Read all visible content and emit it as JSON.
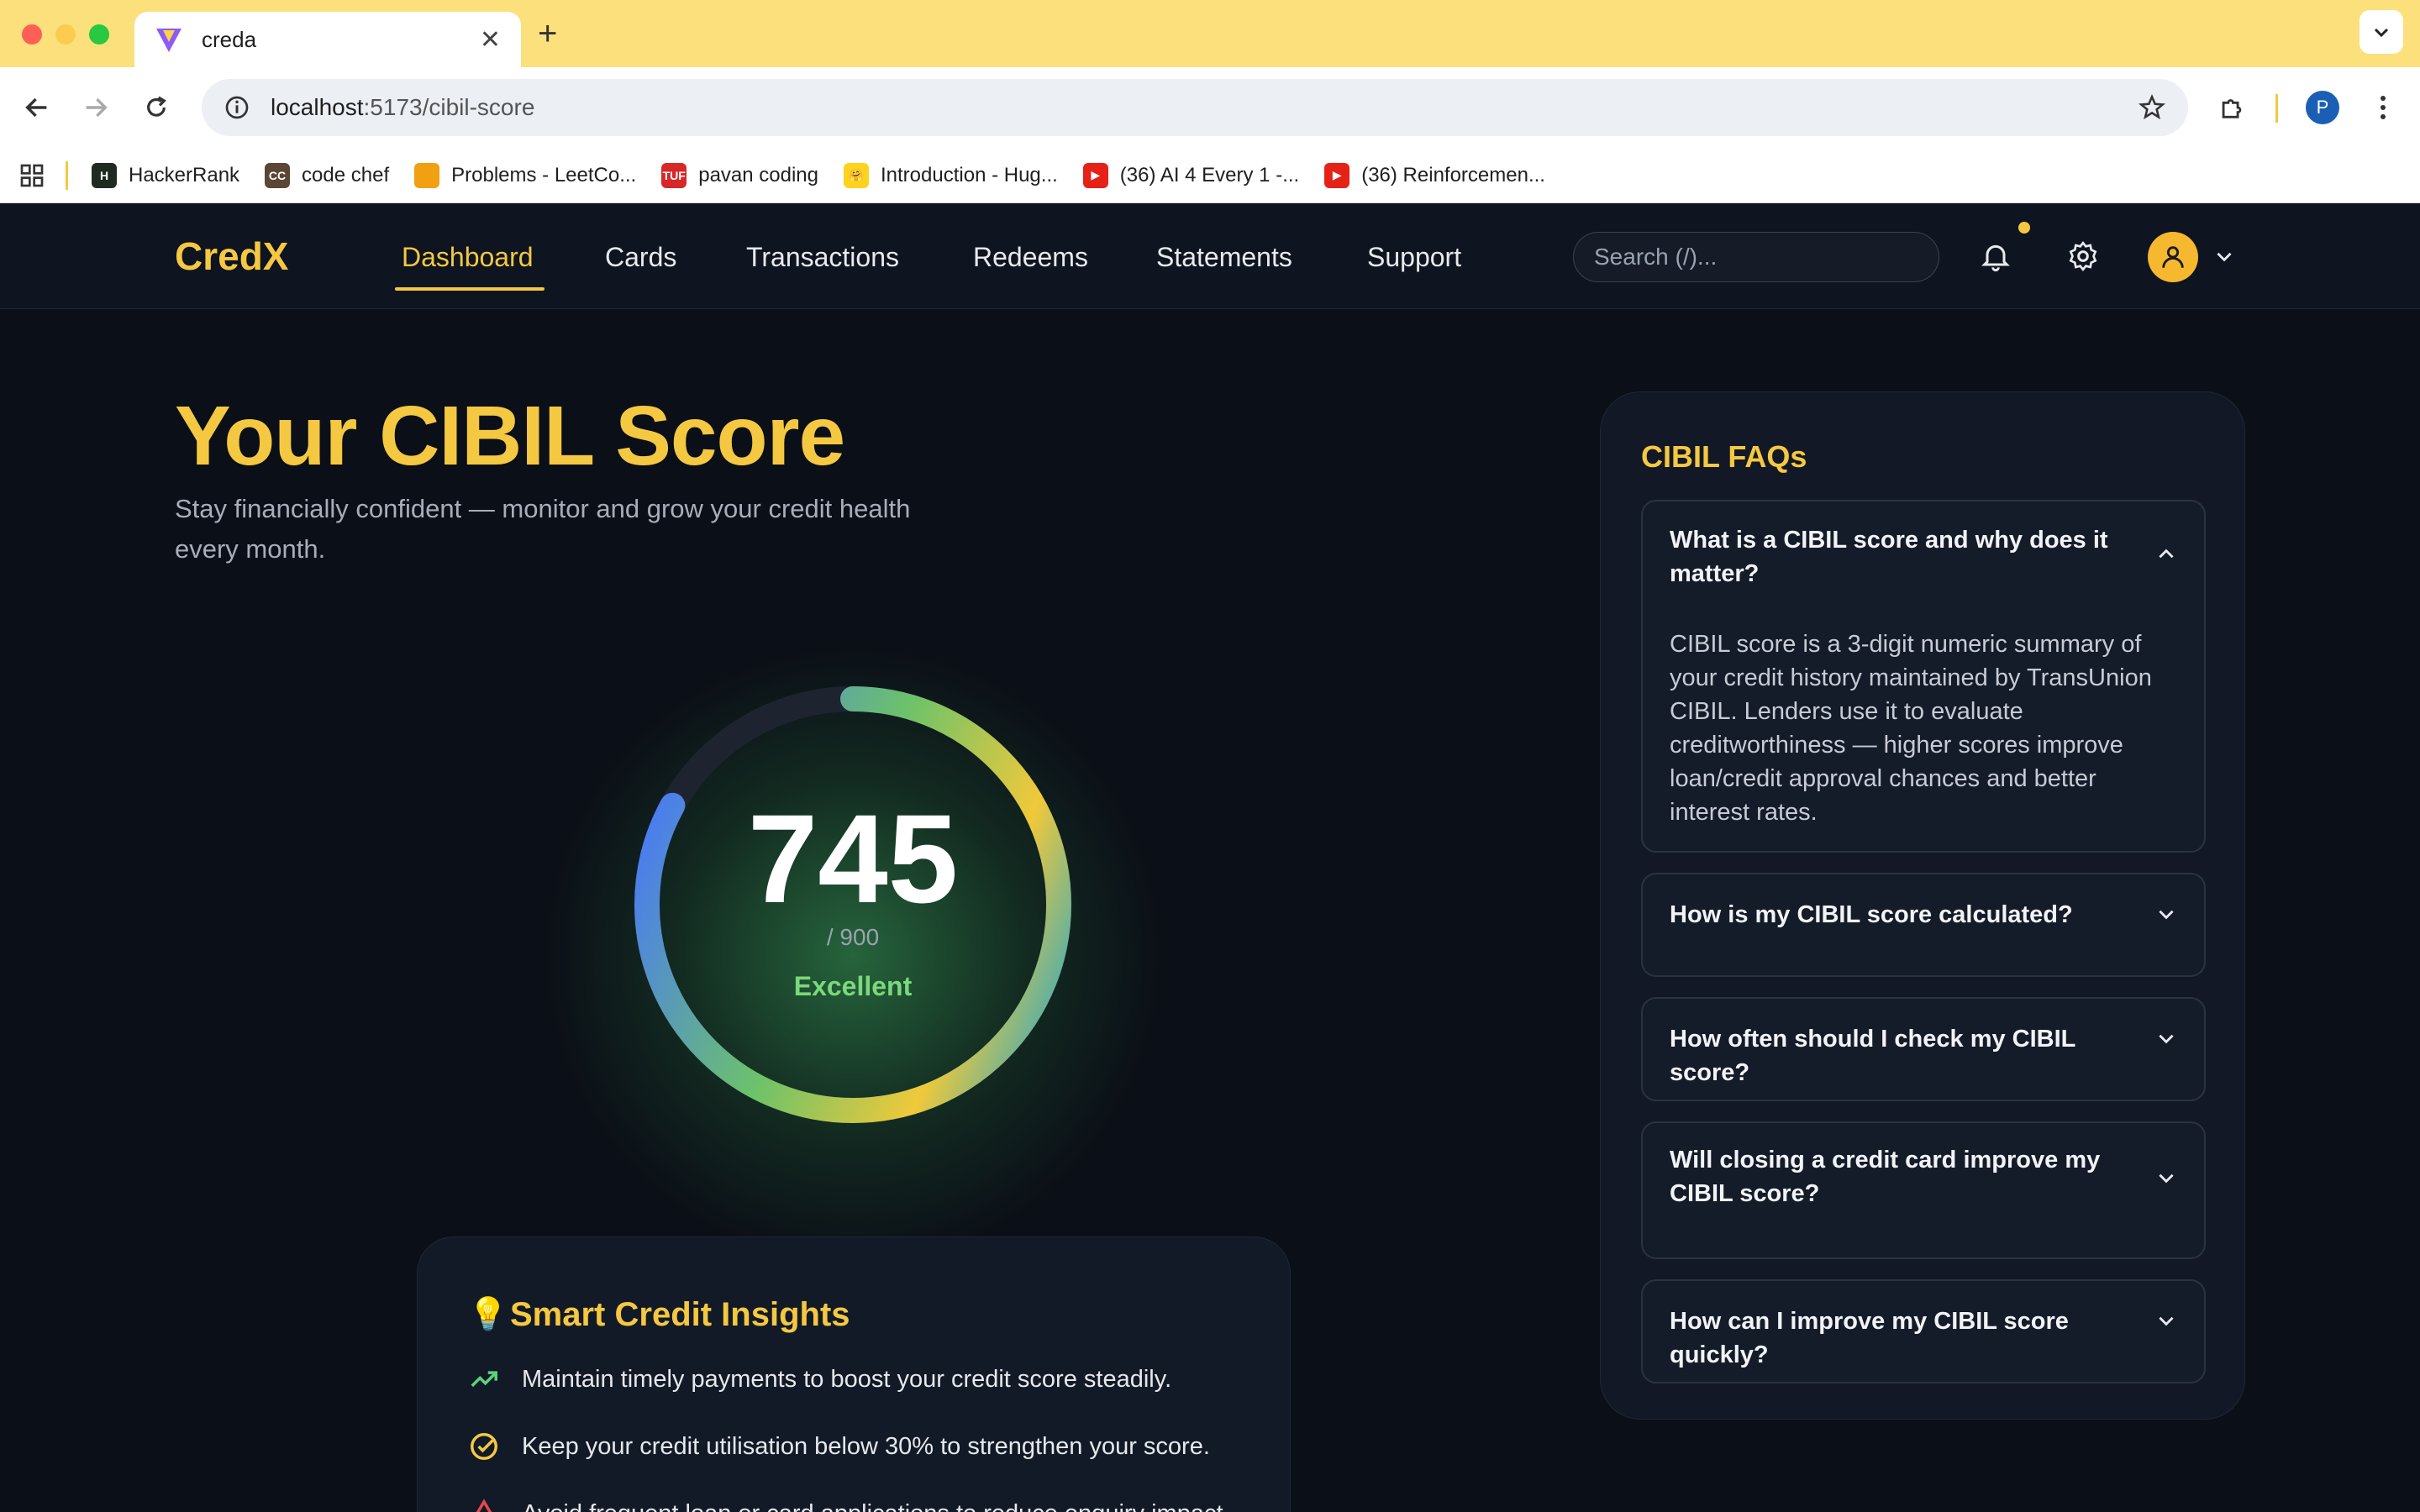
{
  "browser": {
    "tab_title": "creda",
    "url_host": "localhost",
    "url_path": ":5173/cibil-score",
    "profile_initial": "P",
    "bookmarks": [
      {
        "label": "HackerRank",
        "badge": "H",
        "color": "#1f2b20"
      },
      {
        "label": "code chef",
        "badge": "CC",
        "color": "#5b4636"
      },
      {
        "label": "Problems - LeetCo...",
        "badge": "",
        "color": "#f0a010"
      },
      {
        "label": "pavan coding",
        "badge": "TUF",
        "color": "#d62828"
      },
      {
        "label": "Introduction - Hug...",
        "badge": "🤗",
        "color": "#ffd21e"
      },
      {
        "label": "(36) AI 4 Every 1 -...",
        "badge": "▶",
        "color": "#e62117"
      },
      {
        "label": "(36) Reinforcemen...",
        "badge": "▶",
        "color": "#e62117"
      }
    ]
  },
  "nav": {
    "brand": "CredX",
    "links": [
      "Dashboard",
      "Cards",
      "Transactions",
      "Redeems",
      "Statements",
      "Support"
    ],
    "search_placeholder": "Search (/)..."
  },
  "hero": {
    "title": "Your CIBIL Score",
    "subtitle": "Stay financially confident — monitor and grow your credit health every month."
  },
  "score": {
    "value": "745",
    "max_label": "/ 900",
    "rating": "Excellent",
    "fraction": 0.83
  },
  "insights": {
    "title": "Smart Credit Insights",
    "items": [
      "Maintain timely payments to boost your credit score steadily.",
      "Keep your credit utilisation below 30% to strengthen your score.",
      "Avoid frequent loan or card applications to reduce enquiry impact."
    ]
  },
  "faqs": {
    "title": "CIBIL FAQs",
    "items": [
      {
        "q": "What is a CIBIL score and why does it matter?",
        "a": "CIBIL score is a 3-digit numeric summary of your credit history maintained by TransUnion CIBIL. Lenders use it to evaluate creditworthiness — higher scores improve loan/credit approval chances and better interest rates.",
        "open": true
      },
      {
        "q": "How is my CIBIL score calculated?",
        "open": false
      },
      {
        "q": "How often should I check my CIBIL score?",
        "open": false
      },
      {
        "q": "Will closing a credit card improve my CIBIL score?",
        "open": false
      },
      {
        "q": "How can I improve my CIBIL score quickly?",
        "open": false
      }
    ]
  },
  "colors": {
    "accent": "#f5c842",
    "success": "#7bd87b",
    "gauge_start": "#4a7cf0",
    "gauge_end": "#f5c842"
  }
}
